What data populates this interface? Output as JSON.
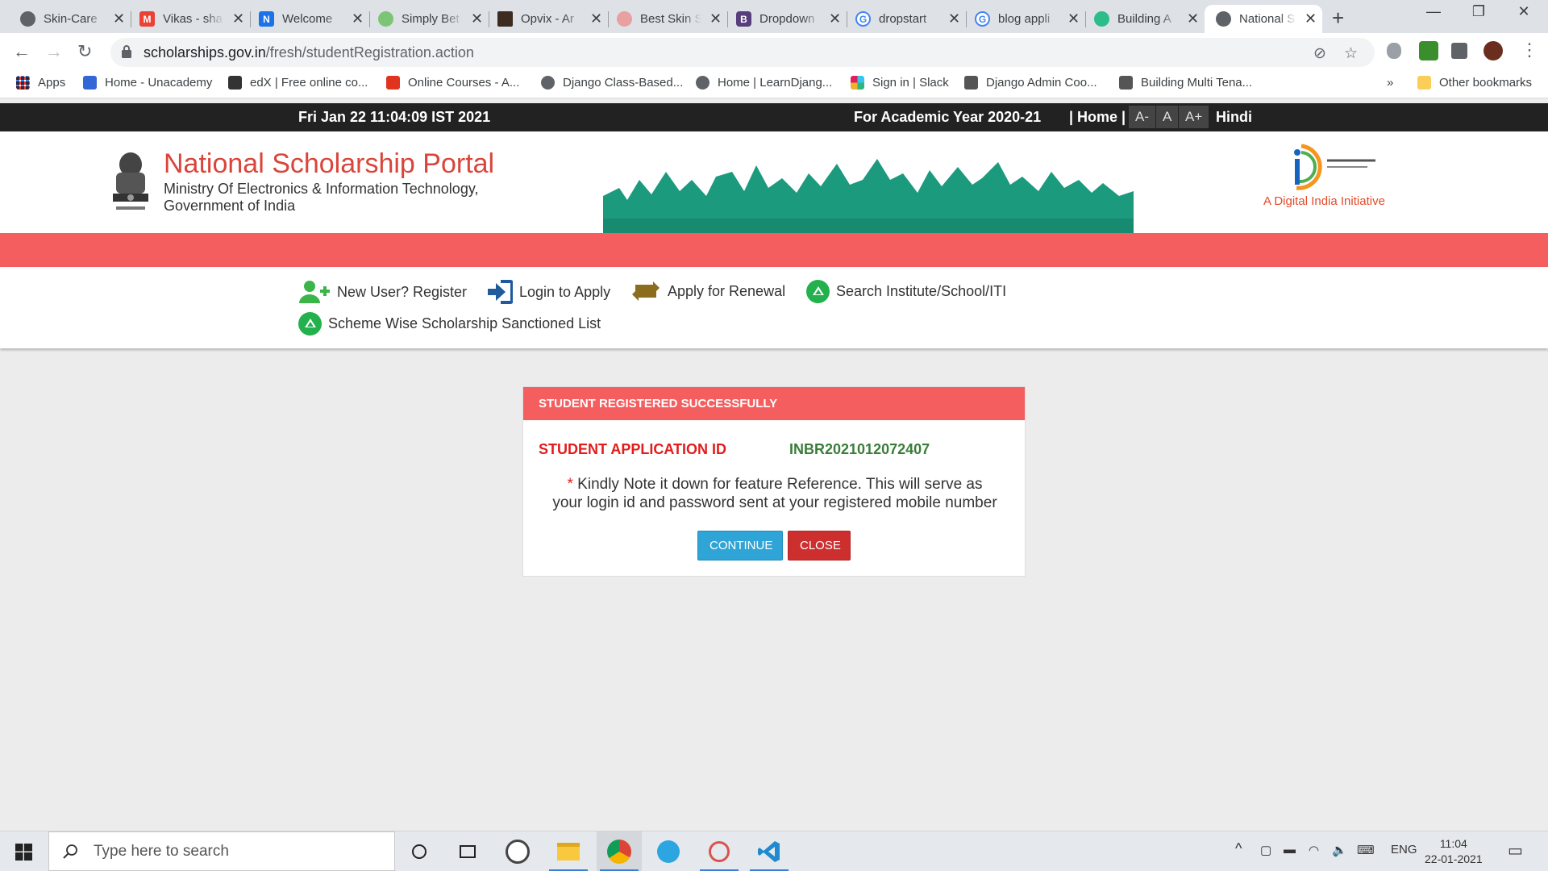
{
  "browser": {
    "tabs": [
      {
        "title": "Skin-Care",
        "icon": "globe-icon",
        "color": "#5f6368"
      },
      {
        "title": "Vikas - sha",
        "icon": "gmail-icon",
        "color": "#ea4335"
      },
      {
        "title": "Welcome",
        "icon": "n-logo-icon",
        "color": "#1a73e8"
      },
      {
        "title": "Simply Bet",
        "icon": "leaf-icon",
        "color": "#7cc576"
      },
      {
        "title": "Opvix - Ar",
        "icon": "opvix-icon",
        "color": "#3d2b1f"
      },
      {
        "title": "Best Skin S",
        "icon": "skin-icon",
        "color": "#e8a0a0"
      },
      {
        "title": "Dropdown",
        "icon": "bootstrap-icon",
        "color": "#563d7c"
      },
      {
        "title": "dropstart",
        "icon": "google-icon",
        "color": "#4285f4"
      },
      {
        "title": "blog appli",
        "icon": "google-icon",
        "color": "#4285f4"
      },
      {
        "title": "Building A",
        "icon": "clover-icon",
        "color": "#2dbd8a"
      },
      {
        "title": "National S",
        "icon": "globe-icon",
        "color": "#5f6368"
      }
    ],
    "url_host": "scholarships.gov.in",
    "url_path": "/fresh/studentRegistration.action",
    "bookmarks": [
      {
        "label": "Apps",
        "color": "#4285f4"
      },
      {
        "label": "Home - Unacademy",
        "color": "#3367d6"
      },
      {
        "label": "edX | Free online co...",
        "color": "#333333"
      },
      {
        "label": "Online Courses - A...",
        "color": "#e0341f"
      },
      {
        "label": "Django Class-Based...",
        "color": "#5f6368"
      },
      {
        "label": "Home | LearnDjang...",
        "color": "#5f6368"
      },
      {
        "label": "Sign in | Slack",
        "color": "#e01e5a"
      },
      {
        "label": "Django Admin Coo...",
        "color": "#555555"
      },
      {
        "label": "Building Multi Tena...",
        "color": "#555555"
      }
    ],
    "bookmarks_overflow": "»",
    "other_bookmarks": "Other bookmarks"
  },
  "site": {
    "datetime": "Fri Jan 22 11:04:09 IST 2021",
    "academic_year": "For Academic Year 2020-21",
    "home_link": "| Home |",
    "font_smaller": "A-",
    "font_normal": "A",
    "font_larger": "A+",
    "hindi": "Hindi",
    "portal_title": "National Scholarship Portal",
    "ministry_line1": "Ministry Of Electronics & Information Technology,",
    "ministry_line2": "Government of India",
    "digital_india_tagline": "A Digital India Initiative",
    "colors": {
      "accent_red": "#f45e5e",
      "title_red": "#d9453b",
      "green": "#22b14c",
      "banner_teal": "#1b9a7e"
    }
  },
  "nav": {
    "register": "New User? Register",
    "login": "Login to Apply",
    "renewal": "Apply for Renewal",
    "search_institute": "Search Institute/School/ITI",
    "sanctioned_list": "Scheme Wise Scholarship Sanctioned List"
  },
  "dialog": {
    "heading": "STUDENT REGISTERED SUCCESSFULLY",
    "app_id_label": "STUDENT APPLICATION ID",
    "app_id_value": "INBR2021012072407",
    "note_star": "*",
    "note_line1": "Kindly Note it down for feature Reference. This will serve as",
    "note_line2": "your login id and password sent at your registered mobile number",
    "continue_label": "CONTINUE",
    "close_label": "CLOSE"
  },
  "taskbar": {
    "search_placeholder": "Type here to search",
    "language": "ENG",
    "time": "11:04",
    "date": "22-01-2021"
  }
}
